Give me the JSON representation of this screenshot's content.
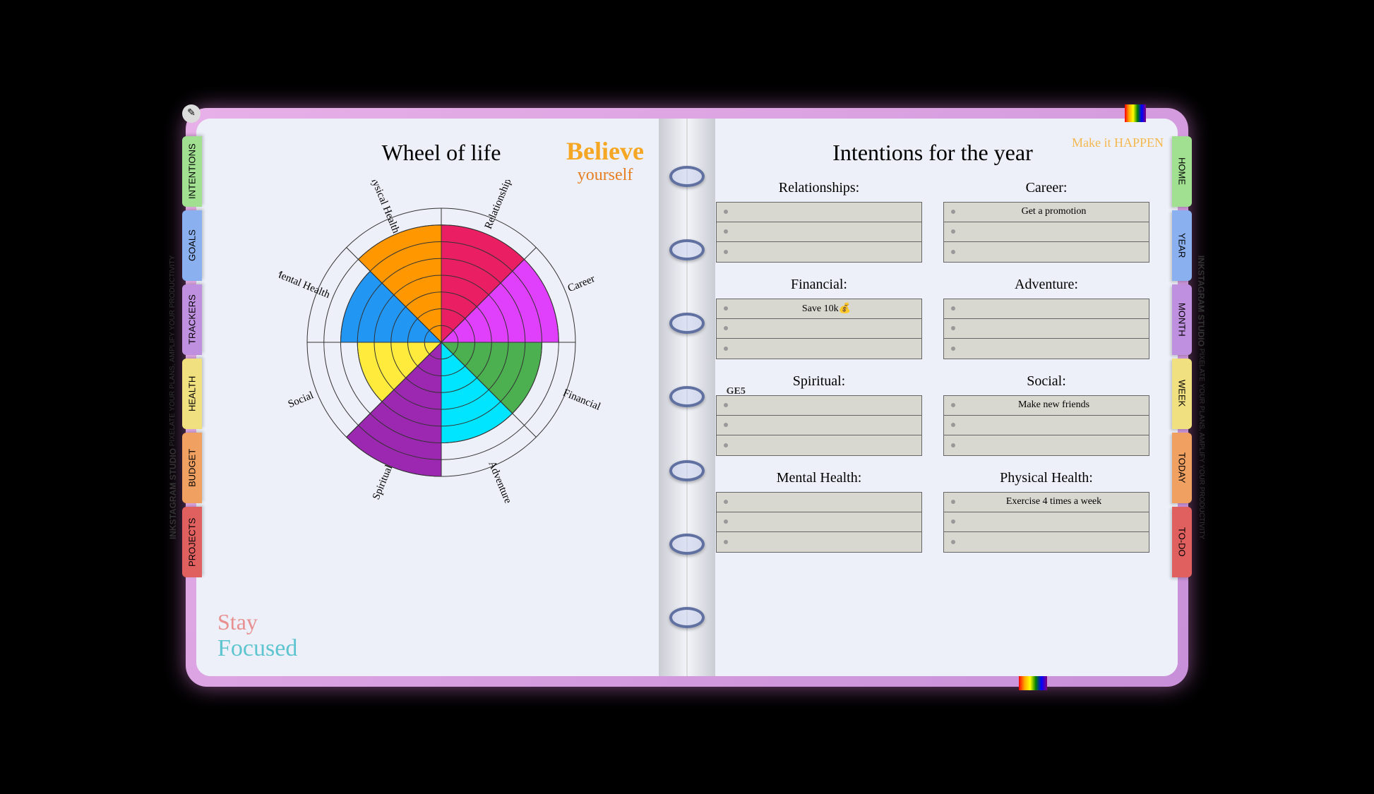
{
  "leftTabs": [
    {
      "label": "INTENTIONS",
      "color": "#a0e090"
    },
    {
      "label": "GOALS",
      "color": "#8ab0f0"
    },
    {
      "label": "TRACKERS",
      "color": "#c090e0"
    },
    {
      "label": "HEALTH",
      "color": "#f0e080"
    },
    {
      "label": "BUDGET",
      "color": "#f0a060"
    },
    {
      "label": "PROJECTS",
      "color": "#e06060"
    }
  ],
  "rightTabs": [
    {
      "label": "HOME",
      "color": "#a0e090"
    },
    {
      "label": "YEAR",
      "color": "#8ab0f0"
    },
    {
      "label": "MONTH",
      "color": "#c090e0"
    },
    {
      "label": "WEEK",
      "color": "#f0e080"
    },
    {
      "label": "TODAY",
      "color": "#f0a060"
    },
    {
      "label": "TO-DO",
      "color": "#e06060"
    }
  ],
  "leftPage": {
    "title": "Wheel of life",
    "stickerBelieve": {
      "line1": "Believe",
      "line2": "yourself"
    },
    "stickerFocused": {
      "line1": "Stay",
      "line2": "Focused"
    },
    "spineText": "GE5"
  },
  "rightPage": {
    "title": "Intentions for the year",
    "stickerMakeIt": "Make it HAPPEN",
    "sections": [
      {
        "title": "Relationships:",
        "rows": [
          "",
          "",
          ""
        ]
      },
      {
        "title": "Career:",
        "rows": [
          "Get a promotion",
          "",
          ""
        ]
      },
      {
        "title": "Financial:",
        "rows": [
          "Save 10k💰",
          "",
          ""
        ]
      },
      {
        "title": "Adventure:",
        "rows": [
          "",
          "",
          ""
        ]
      },
      {
        "title": "Spiritual:",
        "rows": [
          "",
          "",
          ""
        ]
      },
      {
        "title": "Social:",
        "rows": [
          "Make new friends",
          "",
          ""
        ]
      },
      {
        "title": "Mental Health:",
        "rows": [
          "",
          "",
          ""
        ]
      },
      {
        "title": "Physical Health:",
        "rows": [
          "Exercise 4 times a week",
          "",
          ""
        ]
      }
    ]
  },
  "watermark": {
    "brand": "INKSTAGRAM STUDIO",
    "tagline": "PIXELATE YOUR PLANS, AMPLIFY YOUR PRODUCTIVITY"
  },
  "chart_data": {
    "type": "pie",
    "title": "Wheel of life",
    "rings": 8,
    "segments": [
      {
        "name": "Relationships",
        "value": 7,
        "color": "#e91e63"
      },
      {
        "name": "Career",
        "value": 7,
        "color": "#e040fb"
      },
      {
        "name": "Financial",
        "value": 6,
        "color": "#4caf50"
      },
      {
        "name": "Adventure",
        "value": 6,
        "color": "#00e5ff"
      },
      {
        "name": "Spiritual",
        "value": 8,
        "color": "#9c27b0"
      },
      {
        "name": "Social",
        "value": 5,
        "color": "#ffeb3b"
      },
      {
        "name": "Mental Health",
        "value": 6,
        "color": "#2196f3"
      },
      {
        "name": "Physical Health",
        "value": 7,
        "color": "#ff9800"
      }
    ]
  }
}
